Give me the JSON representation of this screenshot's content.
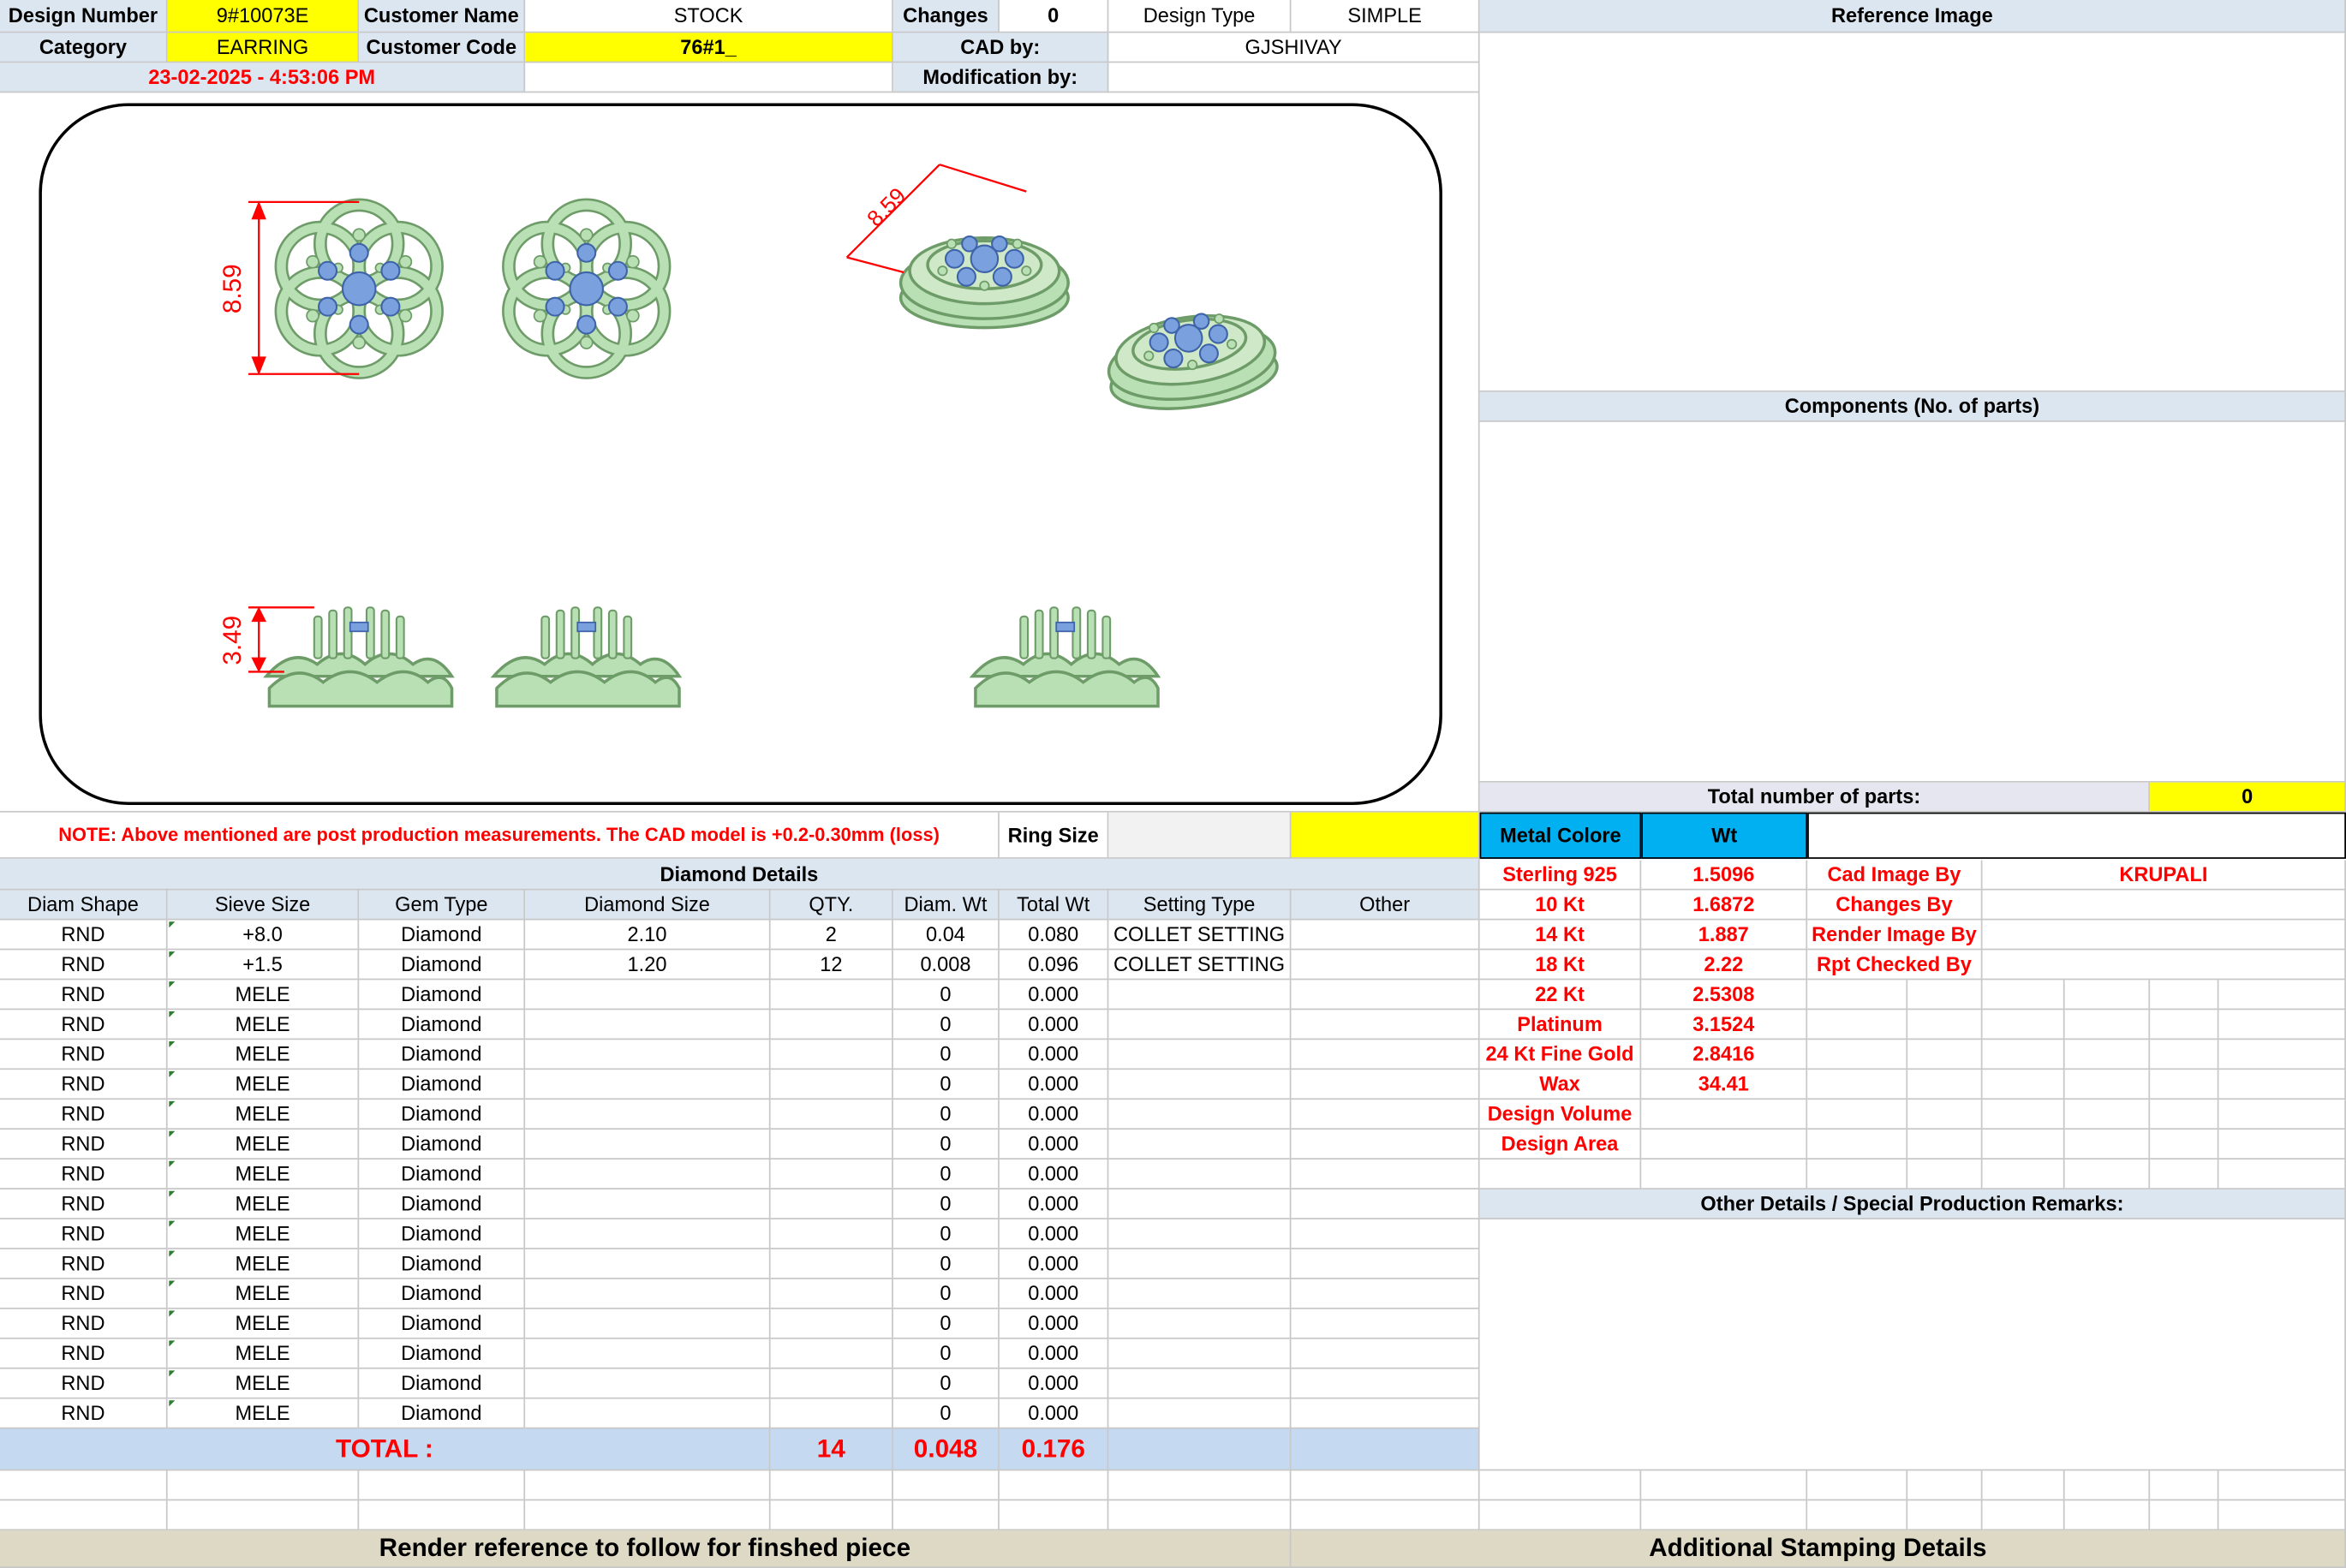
{
  "header": {
    "design_number_label": "Design Number",
    "design_number": "9#10073E",
    "customer_name_label": "Customer Name",
    "customer_name": "STOCK",
    "changes_label": "Changes",
    "changes": "0",
    "design_type_label": "Design Type",
    "design_type": "SIMPLE",
    "reference_image_label": "Reference Image",
    "category_label": "Category",
    "category": "EARRING",
    "customer_code_label": "Customer Code",
    "customer_code": "76#1_",
    "cad_by_label": "CAD by:",
    "cad_by": "GJSHIVAY",
    "date": "23-02-2025 - 4:53:06 PM",
    "modification_by_label": "Modification by:"
  },
  "drawing": {
    "dim_top_left": "8.59",
    "dim_top_angled": "8.59",
    "dim_side": "3.49",
    "colors": {
      "metal": "#b9dfb4",
      "metal_edge": "#6e9c68",
      "stone": "#7aa1dd",
      "dim": "#ff0000"
    }
  },
  "right_panel": {
    "components_label": "Components (No. of parts)",
    "total_parts_label": "Total number of parts:",
    "total_parts": "0",
    "metal_colore_label": "Metal Colore",
    "wt_label": "Wt",
    "metals": [
      {
        "name": "Sterling 925",
        "wt": "1.5096"
      },
      {
        "name": "10 Kt",
        "wt": "1.6872"
      },
      {
        "name": "14 Kt",
        "wt": "1.887"
      },
      {
        "name": "18 Kt",
        "wt": "2.22"
      },
      {
        "name": "22 Kt",
        "wt": "2.5308"
      },
      {
        "name": "Platinum",
        "wt": "3.1524"
      },
      {
        "name": "24 Kt Fine Gold",
        "wt": "2.8416"
      },
      {
        "name": "Wax",
        "wt": "34.41"
      },
      {
        "name": "Design Volume",
        "wt": ""
      },
      {
        "name": "Design Area",
        "wt": ""
      }
    ],
    "people": [
      {
        "label": "Cad Image By",
        "value": "KRUPALI"
      },
      {
        "label": "Changes By",
        "value": ""
      },
      {
        "label": "Render Image By",
        "value": ""
      },
      {
        "label": "Rpt Checked By",
        "value": ""
      }
    ],
    "other_details_label": "Other Details / Special Production Remarks:"
  },
  "note": "NOTE: Above mentioned are post production measurements. The CAD model is +0.2-0.30mm (loss)",
  "ring_size_label": "Ring Size",
  "diamond": {
    "title": "Diamond Details",
    "headers": [
      "Diam Shape",
      "Sieve Size",
      "Gem Type",
      "Diamond Size",
      "QTY.",
      "Diam. Wt",
      "Total Wt",
      "Setting Type",
      "Other"
    ],
    "rows": [
      [
        "RND",
        "+8.0",
        "Diamond",
        "2.10",
        "2",
        "0.04",
        "0.080",
        "COLLET SETTING",
        ""
      ],
      [
        "RND",
        "+1.5",
        "Diamond",
        "1.20",
        "12",
        "0.008",
        "0.096",
        "COLLET SETTING",
        ""
      ],
      [
        "RND",
        "MELE",
        "Diamond",
        "",
        "",
        "0",
        "0.000",
        "",
        ""
      ],
      [
        "RND",
        "MELE",
        "Diamond",
        "",
        "",
        "0",
        "0.000",
        "",
        ""
      ],
      [
        "RND",
        "MELE",
        "Diamond",
        "",
        "",
        "0",
        "0.000",
        "",
        ""
      ],
      [
        "RND",
        "MELE",
        "Diamond",
        "",
        "",
        "0",
        "0.000",
        "",
        ""
      ],
      [
        "RND",
        "MELE",
        "Diamond",
        "",
        "",
        "0",
        "0.000",
        "",
        ""
      ],
      [
        "RND",
        "MELE",
        "Diamond",
        "",
        "",
        "0",
        "0.000",
        "",
        ""
      ],
      [
        "RND",
        "MELE",
        "Diamond",
        "",
        "",
        "0",
        "0.000",
        "",
        ""
      ],
      [
        "RND",
        "MELE",
        "Diamond",
        "",
        "",
        "0",
        "0.000",
        "",
        ""
      ],
      [
        "RND",
        "MELE",
        "Diamond",
        "",
        "",
        "0",
        "0.000",
        "",
        ""
      ],
      [
        "RND",
        "MELE",
        "Diamond",
        "",
        "",
        "0",
        "0.000",
        "",
        ""
      ],
      [
        "RND",
        "MELE",
        "Diamond",
        "",
        "",
        "0",
        "0.000",
        "",
        ""
      ],
      [
        "RND",
        "MELE",
        "Diamond",
        "",
        "",
        "0",
        "0.000",
        "",
        ""
      ],
      [
        "RND",
        "MELE",
        "Diamond",
        "",
        "",
        "0",
        "0.000",
        "",
        ""
      ],
      [
        "RND",
        "MELE",
        "Diamond",
        "",
        "",
        "0",
        "0.000",
        "",
        ""
      ],
      [
        "RND",
        "MELE",
        "Diamond",
        "",
        "",
        "0",
        "0.000",
        "",
        ""
      ]
    ],
    "total_label": "TOTAL :",
    "total_qty": "14",
    "total_diam_wt": "0.048",
    "total_wt": "0.176"
  },
  "footer": {
    "render_ref": "Render reference to follow for finshed piece",
    "stamping": "Additional Stamping Details"
  }
}
